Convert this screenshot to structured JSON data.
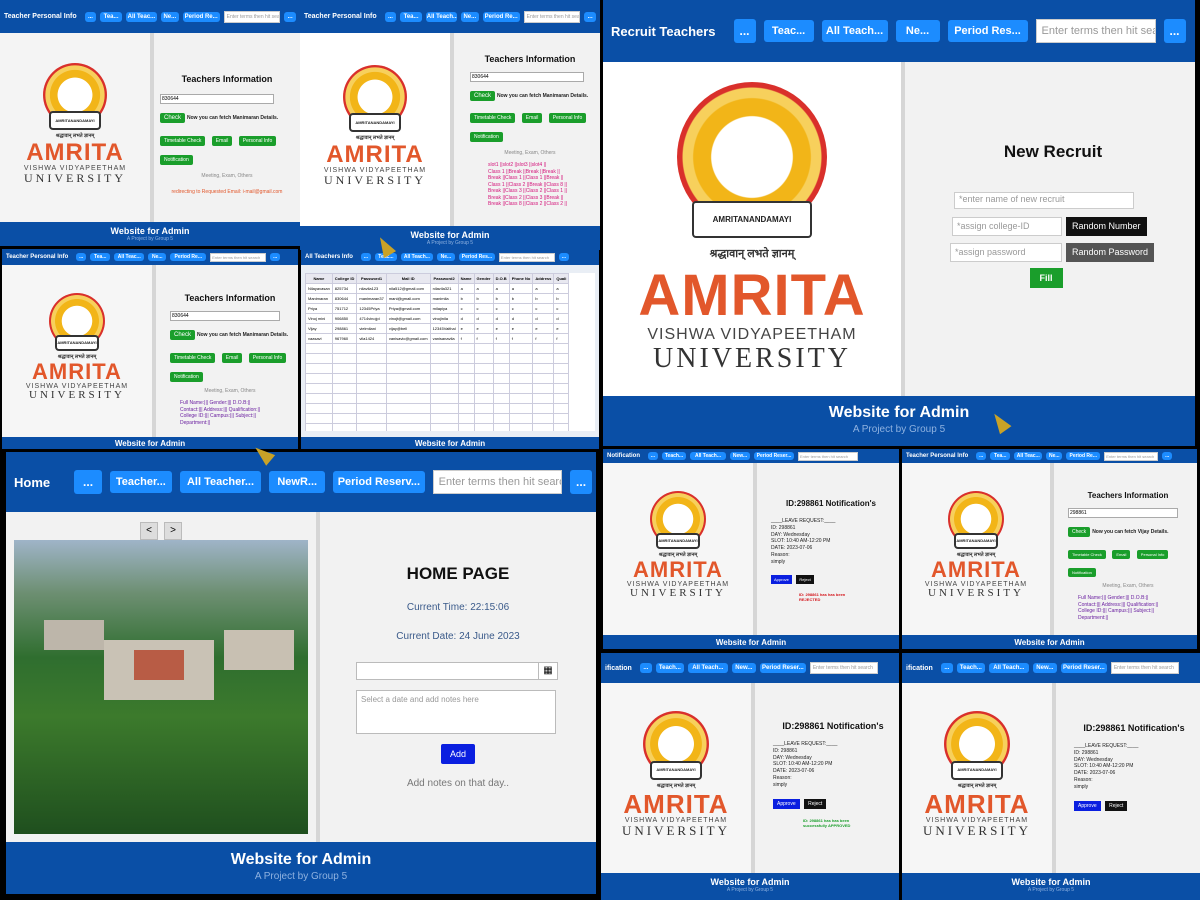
{
  "common": {
    "footer_title": "Website for Admin",
    "footer_sub": "A Project by Group 5",
    "search_placeholder": "Enter terms then hit search",
    "more_label": "...",
    "logo": {
      "hindi": "श्रद्धावान् लभते ज्ञानम्",
      "amrita": "AMRITA",
      "vv": "VISHWA VIDYAPEETHAM",
      "univ": "UNIVERSITY",
      "ribbon": "AMRITANANDAMAYI"
    }
  },
  "panel1": {
    "nav": [
      "Tea...",
      "All Teac...",
      "Ne...",
      "Period Re..."
    ],
    "title": "Teacher Personal Info",
    "heading": "Teachers Information",
    "input_value": "830644",
    "check": "Check",
    "fetch_text": "Now you can fetch Manimaran Details.",
    "buttons": [
      "Timetable Check",
      "Email",
      "Personal Info",
      "Notification"
    ],
    "meeting": "Meeting, Exam, Others",
    "redirect": "redirecting to Requested Email: i-mail@gmail.com"
  },
  "panel2": {
    "nav": [
      "Tea...",
      "All Teach...",
      "Ne...",
      "Period Re..."
    ],
    "title": "Teacher Personal Info",
    "heading": "Teachers Information",
    "input_value": "830644",
    "check": "Check",
    "fetch_text": "Now you can fetch Manimaran Details.",
    "buttons": [
      "Timetable Check",
      "Email",
      "Personal Info",
      "Notification"
    ],
    "meeting": "Meeting, Exam, Others",
    "slots": [
      "slot1 ||slot2 ||slot3 ||slot4 ||",
      "Class 1 ||Break ||Break ||Break ||",
      "Break ||Class 1 ||Class 1 ||Break ||",
      "Class 1 ||Class 2 ||Break ||Class 8 ||",
      "Break ||Class 3 ||Class 2 ||Class 1 ||",
      "Break ||Class 2 ||Class 3 ||Break ||",
      "Break ||Class 8 ||Class 2 ||Class 2 ||"
    ]
  },
  "panel3": {
    "title": "Recruit Teachers",
    "nav": [
      "...",
      "Teac...",
      "All Teach...",
      "Ne...",
      "Period Res..."
    ],
    "heading": "New Recruit",
    "name_placeholder": "*enter name of new recruit",
    "id_placeholder": "*assign college-ID",
    "pwd_placeholder": "*assign password",
    "random_number": "Random Number",
    "random_password": "Random Password",
    "fill": "Fill"
  },
  "panel4": {
    "title": "Teacher Personal Info",
    "nav": [
      "...",
      "Tea...",
      "All Teac...",
      "Ne...",
      "Period Re..."
    ],
    "heading": "Teachers Information",
    "input_value": "830644",
    "check": "Check",
    "fetch_text": "Now you can fetch Manimaran Details.",
    "buttons": [
      "Timetable Check",
      "Email",
      "Personal Info",
      "Notification"
    ],
    "meeting": "Meeting, Exam, Others",
    "details": [
      "Full Name:||| Gender:||| D.O.B:||",
      "Contact:||| Address:||| Qualification:||",
      "College ID:||| Campus:||| Subject:||",
      "Department:||"
    ]
  },
  "panel5": {
    "title": "All Teachers Info",
    "nav": [
      "...",
      "Teac...",
      "All Teach...",
      "Ne...",
      "Period Res..."
    ],
    "columns": [
      "Name",
      "College ID",
      "Password1",
      "Mail ID",
      "Password2",
      "Name",
      "Gender",
      "D.O.B",
      "Phone No",
      "Address",
      "Quali"
    ],
    "rows": [
      [
        "Nilayavasan",
        "825734",
        "nilavila123",
        "nila512@gmail.com",
        "nilavila321",
        "a",
        "a",
        "a",
        "a",
        "a",
        "a"
      ],
      [
        "Manimaran",
        "830644",
        "manimaran37",
        "mani@gmail.com",
        "manimila",
        "b",
        "b",
        "b",
        "b",
        "b",
        "b"
      ],
      [
        "Priya",
        "751712",
        "12345Priya",
        "Priya@gmail.com",
        "milapiya",
        "c",
        "c",
        "c",
        "c",
        "c",
        "c"
      ],
      [
        "Vinoj mini",
        "906850",
        "4714vinojpi",
        "vinojt@gmail.com",
        "vinojinila",
        "d",
        "d",
        "d",
        "d",
        "d",
        "d"
      ],
      [
        "Vijay",
        "298861",
        "vielmilani",
        "vijay@bell",
        "12345Vaithal",
        "e",
        "e",
        "e",
        "e",
        "e",
        "e"
      ],
      [
        "vaasavi",
        "967960",
        "vila1424",
        "vanisavic@gmail.com",
        "vanisanavila",
        "f",
        "f",
        "f",
        "f",
        "f",
        "f"
      ]
    ]
  },
  "panel6": {
    "title": "Home",
    "nav": [
      "...",
      "Teacher...",
      "All Teacher...",
      "NewR...",
      "Period Reserv..."
    ],
    "heading": "HOME PAGE",
    "time": "Current Time: 22:15:06",
    "date": "Current Date: 24 June 2023",
    "notes_placeholder": "Select a date and add notes here",
    "add": "Add",
    "add_notes": "Add notes on that day..",
    "prev": "<",
    "next": ">"
  },
  "notif_common": {
    "heading": "ID:298861 Notification's",
    "leave": "____LEAVE REQUEST:____",
    "id": "ID: 298861",
    "day": "DAY: Wednesday",
    "slot": "SLOT: 10:40 AM-12:20 PM",
    "date": "DATE: 2023-07-06",
    "reason": "Reason:",
    "reason_val": "simply",
    "approve": "Approve",
    "reject": "Reject"
  },
  "panel7": {
    "title": "Notification",
    "nav": [
      "...",
      "Teach...",
      "All Teach...",
      "New...",
      "Period Reser..."
    ],
    "status": "ID: 298861 has has been REJECTED",
    "status_color": "#d4141a"
  },
  "panel8": {
    "title": "Teacher Personal Info",
    "nav": [
      "...",
      "Tea...",
      "All Teac...",
      "Ne...",
      "Period Re..."
    ],
    "heading": "Teachers Information",
    "input_value": "298861",
    "check": "Check",
    "fetch_text": "Now you can fetch Vijay Details.",
    "buttons": [
      "Timetable Check",
      "Email",
      "Personal Info",
      "Notification"
    ],
    "meeting": "Meeting, Exam, Others",
    "details": [
      "Full Name:||| Gender:||| D.O.B:||",
      "Contact:||| Address:||| Qualification:||",
      "College ID:||| Campus:||| Subject:||",
      "Department:||"
    ]
  },
  "panel9": {
    "title": "ification",
    "nav": [
      "...",
      "Teach...",
      "All Teach...",
      "New...",
      "Period Reser..."
    ],
    "status": "ID: 298861 has has been successfully APPROVED",
    "status_color": "#1a9e2b"
  },
  "panel10": {
    "title": "ification",
    "nav": [
      "...",
      "Teach...",
      "All Teach...",
      "New...",
      "Period Reser..."
    ]
  }
}
